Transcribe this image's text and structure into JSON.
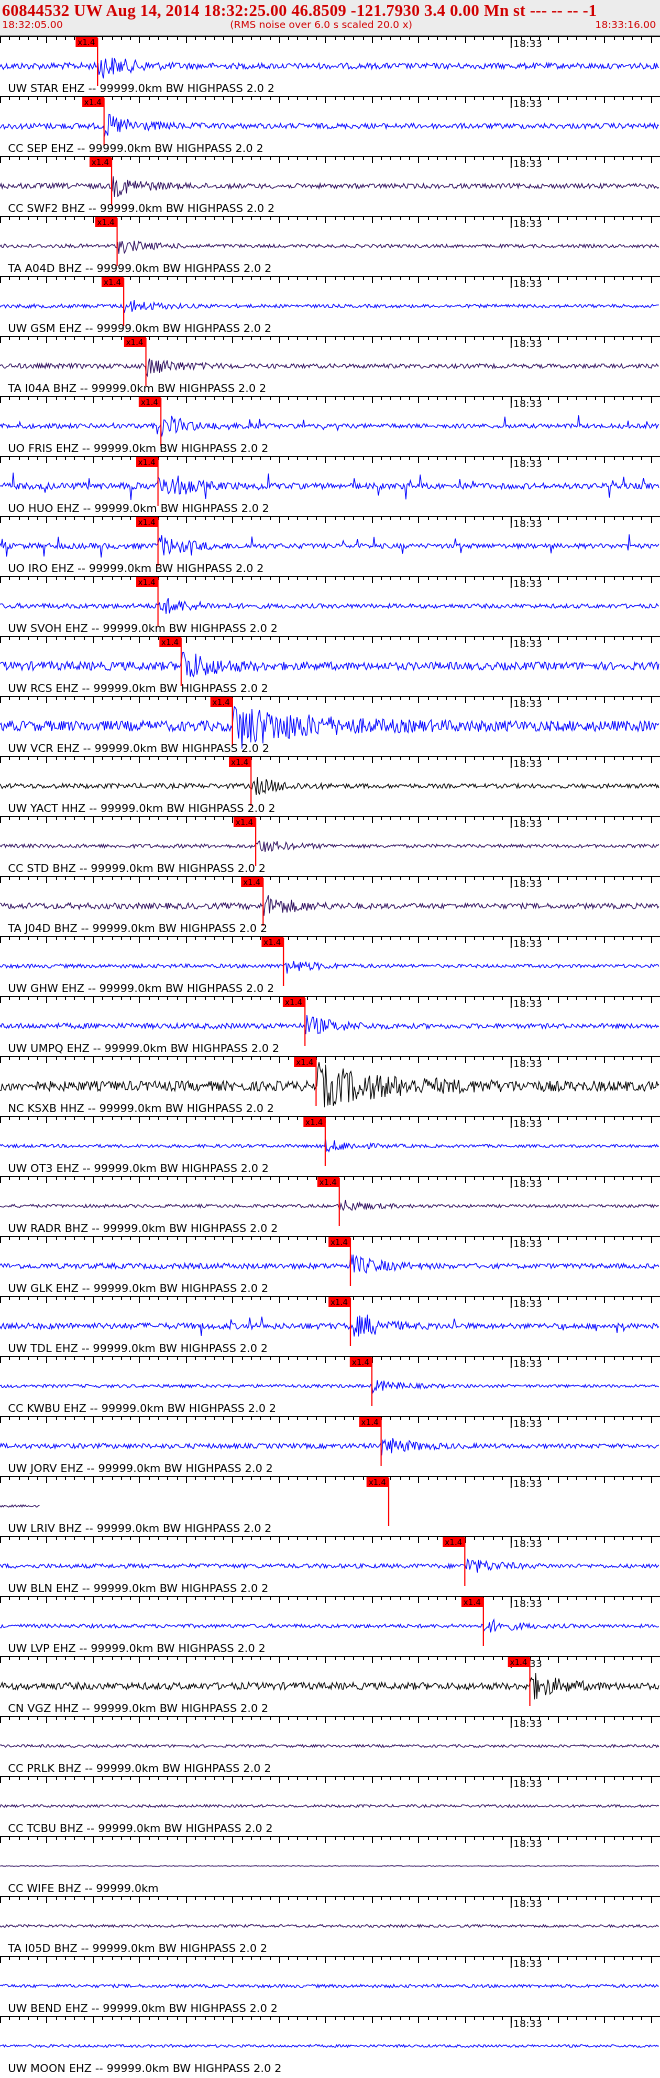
{
  "header": {
    "title": "60844532 UW Aug 14, 2014 18:32:25.00   46.8509 -121.7930  3.4 0.00 Mn st --- -- --   -1",
    "start_time": "18:32:05.00",
    "note": "(RMS noise over 6.0 s scaled 20.0 x)",
    "end_time": "18:33:16.00"
  },
  "chart_data": {
    "type": "line",
    "title": "60844532 UW Aug 14, 2014 18:32:25.00   46.8509 -121.7930  3.4 0.00 Mn st --- -- --   -1",
    "x_start": "18:32:05.00",
    "x_end": "18:33:16.00",
    "time_marker_label": "18:33",
    "pick_label": "x1.4",
    "colors": {
      "blue": "#0000ff",
      "purple": "#2a0a5a",
      "black": "#000000",
      "pick": "#ff0000"
    },
    "traces": [
      {
        "label": "UW STAR EHZ -- 99999.0km BW  HIGHPASS  2.0  2",
        "color": "blue",
        "pick_s": 10.5,
        "activity": "arrival",
        "amp": 0.6
      },
      {
        "label": "CC SEP EHZ -- 99999.0km BW  HIGHPASS  2.0  2",
        "color": "blue",
        "pick_s": 11.2,
        "activity": "arrival",
        "amp": 0.55
      },
      {
        "label": "CC SWF2 BHZ -- 99999.0km BW  HIGHPASS  2.0  2",
        "color": "purple",
        "pick_s": 12.0,
        "activity": "noise",
        "amp": 0.5
      },
      {
        "label": "TA A04D BHZ -- 99999.0km BW  HIGHPASS  2.0  2",
        "color": "purple",
        "pick_s": 12.6,
        "activity": "noise",
        "amp": 0.35
      },
      {
        "label": "UW GSM EHZ -- 99999.0km BW  HIGHPASS  2.0  2",
        "color": "blue",
        "pick_s": 13.3,
        "activity": "noise",
        "amp": 0.35
      },
      {
        "label": "TA I04A BHZ -- 99999.0km BW  HIGHPASS  2.0  2",
        "color": "purple",
        "pick_s": 15.7,
        "activity": "arrival",
        "amp": 0.45
      },
      {
        "label": "UO FRIS EHZ -- 99999.0km BW  HIGHPASS  2.0  2",
        "color": "blue",
        "pick_s": 17.3,
        "activity": "spiky",
        "amp": 0.45
      },
      {
        "label": "UO HUO EHZ -- 99999.0km BW  HIGHPASS  2.0  2",
        "color": "blue",
        "pick_s": 17.0,
        "activity": "spiky",
        "amp": 0.6
      },
      {
        "label": "UO IRO EHZ -- 99999.0km BW  HIGHPASS  2.0  2",
        "color": "blue",
        "pick_s": 17.0,
        "activity": "spiky",
        "amp": 0.5
      },
      {
        "label": "UW SVOH EHZ -- 99999.0km BW  HIGHPASS  2.0  2",
        "color": "blue",
        "pick_s": 17.0,
        "activity": "arrival",
        "amp": 0.45
      },
      {
        "label": "UW RCS EHZ -- 99999.0km BW  HIGHPASS  2.0  2",
        "color": "blue",
        "pick_s": 19.5,
        "activity": "arrival",
        "amp": 0.8
      },
      {
        "label": "UW VCR EHZ -- 99999.0km BW  HIGHPASS  2.0  2",
        "color": "blue",
        "pick_s": 25.0,
        "activity": "burst",
        "amp": 0.95
      },
      {
        "label": "UW YACT HHZ -- 99999.0km BW  HIGHPASS  2.0  2",
        "color": "black",
        "pick_s": 27.0,
        "activity": "arrival",
        "amp": 0.45
      },
      {
        "label": "CC STD BHZ -- 99999.0km BW  HIGHPASS  2.0  2",
        "color": "purple",
        "pick_s": 27.5,
        "activity": "noise",
        "amp": 0.35
      },
      {
        "label": "TA J04D BHZ -- 99999.0km BW  HIGHPASS  2.0  2",
        "color": "purple",
        "pick_s": 28.3,
        "activity": "arrival",
        "amp": 0.55
      },
      {
        "label": "UW GHW EHZ -- 99999.0km BW  HIGHPASS  2.0  2",
        "color": "blue",
        "pick_s": 30.5,
        "activity": "noise",
        "amp": 0.35
      },
      {
        "label": "UW UMPQ EHZ -- 99999.0km BW  HIGHPASS  2.0  2",
        "color": "blue",
        "pick_s": 32.8,
        "activity": "arrival",
        "amp": 0.5
      },
      {
        "label": "NC KSXB HHZ -- 99999.0km BW  HIGHPASS  2.0  2",
        "color": "black",
        "pick_s": 34.0,
        "activity": "burst",
        "amp": 0.9
      },
      {
        "label": "UW OT3 EHZ -- 99999.0km BW  HIGHPASS  2.0  2",
        "color": "blue",
        "pick_s": 35.0,
        "activity": "noise",
        "amp": 0.3
      },
      {
        "label": "UW RADR BHZ -- 99999.0km BW  HIGHPASS  2.0  2",
        "color": "purple",
        "pick_s": 36.5,
        "activity": "noise",
        "amp": 0.3
      },
      {
        "label": "UW GLK EHZ -- 99999.0km BW  HIGHPASS  2.0  2",
        "color": "blue",
        "pick_s": 37.7,
        "activity": "arrival",
        "amp": 0.5
      },
      {
        "label": "UW TDL EHZ -- 99999.0km BW  HIGHPASS  2.0  2",
        "color": "blue",
        "pick_s": 37.7,
        "activity": "spiky",
        "amp": 0.55
      },
      {
        "label": "CC KWBU EHZ -- 99999.0km BW  HIGHPASS  2.0  2",
        "color": "blue",
        "pick_s": 40.0,
        "activity": "noise",
        "amp": 0.3
      },
      {
        "label": "UW JORV EHZ -- 99999.0km BW  HIGHPASS  2.0  2",
        "color": "blue",
        "pick_s": 41.0,
        "activity": "arrival",
        "amp": 0.45
      },
      {
        "label": "UW LRIV BHZ -- 99999.0km BW  HIGHPASS  2.0  2",
        "color": "purple",
        "pick_s": 41.8,
        "activity": "short",
        "amp": 0.2
      },
      {
        "label": "UW BLN EHZ -- 99999.0km BW  HIGHPASS  2.0  2",
        "color": "blue",
        "pick_s": 50.0,
        "activity": "arrival",
        "amp": 0.4
      },
      {
        "label": "UW LVP EHZ -- 99999.0km BW  HIGHPASS  2.0  2",
        "color": "blue",
        "pick_s": 52.0,
        "activity": "noise",
        "amp": 0.35
      },
      {
        "label": "CN VGZ HHZ -- 99999.0km BW  HIGHPASS  2.0  2",
        "color": "black",
        "pick_s": 57.0,
        "activity": "arrival",
        "amp": 0.65
      },
      {
        "label": "CC PRLK BHZ -- 99999.0km BW  HIGHPASS  2.0  2",
        "color": "purple",
        "pick_s": null,
        "activity": "noise",
        "amp": 0.25
      },
      {
        "label": "CC TCBU BHZ -- 99999.0km BW  HIGHPASS  2.0  2",
        "color": "purple",
        "pick_s": null,
        "activity": "noise",
        "amp": 0.25
      },
      {
        "label": "CC WIFE BHZ -- 99999.0km",
        "color": "purple",
        "pick_s": null,
        "activity": "flat",
        "amp": 0
      },
      {
        "label": "TA I05D BHZ -- 99999.0km BW  HIGHPASS  2.0  2",
        "color": "purple",
        "pick_s": null,
        "activity": "noise",
        "amp": 0.25
      },
      {
        "label": "UW BEND EHZ -- 99999.0km BW  HIGHPASS  2.0  2",
        "color": "blue",
        "pick_s": null,
        "activity": "noise",
        "amp": 0.3
      },
      {
        "label": "UW MOON EHZ -- 99999.0km BW  HIGHPASS  2.0  2",
        "color": "blue",
        "pick_s": null,
        "activity": "noise",
        "amp": 0.25
      }
    ]
  }
}
